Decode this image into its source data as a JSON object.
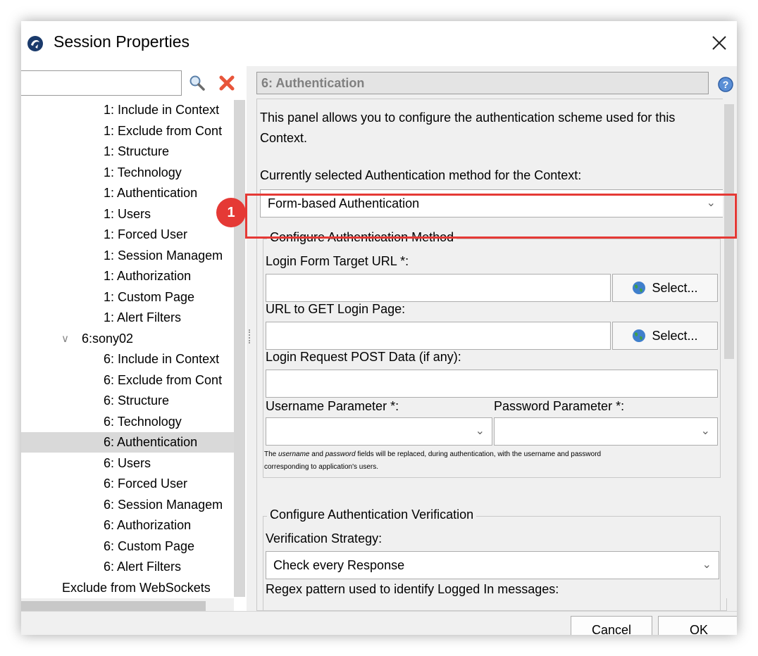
{
  "window": {
    "title": "Session Properties"
  },
  "search": {
    "value": "",
    "placeholder": ""
  },
  "tree": {
    "items": [
      {
        "label": "1: Include in Context"
      },
      {
        "label": "1: Exclude from Cont"
      },
      {
        "label": "1: Structure"
      },
      {
        "label": "1: Technology"
      },
      {
        "label": "1: Authentication"
      },
      {
        "label": "1: Users"
      },
      {
        "label": "1: Forced User"
      },
      {
        "label": "1: Session Managem"
      },
      {
        "label": "1: Authorization"
      },
      {
        "label": "1: Custom Page"
      },
      {
        "label": "1: Alert Filters"
      },
      {
        "label": "6:sony02"
      },
      {
        "label": "6: Include in Context"
      },
      {
        "label": "6: Exclude from Cont"
      },
      {
        "label": "6: Structure"
      },
      {
        "label": "6: Technology"
      },
      {
        "label": "6: Authentication"
      },
      {
        "label": "6: Users"
      },
      {
        "label": "6: Forced User"
      },
      {
        "label": "6: Session Managem"
      },
      {
        "label": "6: Authorization"
      },
      {
        "label": "6: Custom Page"
      },
      {
        "label": "6: Alert Filters"
      },
      {
        "label": "Exclude from WebSockets"
      }
    ],
    "selected": "6: Authentication"
  },
  "panel": {
    "title": "6: Authentication",
    "description": "This panel allows you to configure the authentication scheme used for this Context.",
    "method_label": "Currently selected Authentication method for the Context:",
    "method_value": "Form-based Authentication",
    "marker": "1",
    "configure_group": {
      "legend": "Configure Authentication Method",
      "login_target_label": "Login Form Target URL *:",
      "login_target_value": "",
      "select_button": "Select...",
      "get_login_label": "URL to GET Login Page:",
      "get_login_value": "",
      "post_data_label": "Login Request POST Data (if any):",
      "post_data_value": "",
      "username_param_label": "Username Parameter *:",
      "password_param_label": "Password Parameter *:",
      "username_param_value": "",
      "password_param_value": "",
      "note_prefix": "The ",
      "note_username": "username",
      "note_and": " and ",
      "note_password": "password",
      "note_rest": " fields will be replaced, during authentication, with the username and password",
      "note_line2": "corresponding to application's users."
    },
    "verification_group": {
      "legend": "Configure Authentication Verification",
      "strategy_label": "Verification Strategy:",
      "strategy_value": "Check every Response",
      "regex_label": "Regex pattern used to identify Logged In messages:"
    }
  },
  "buttons": {
    "cancel": "Cancel",
    "ok": "OK"
  },
  "colors": {
    "highlight": "#e53935",
    "selected_row": "#d9d9d9"
  }
}
